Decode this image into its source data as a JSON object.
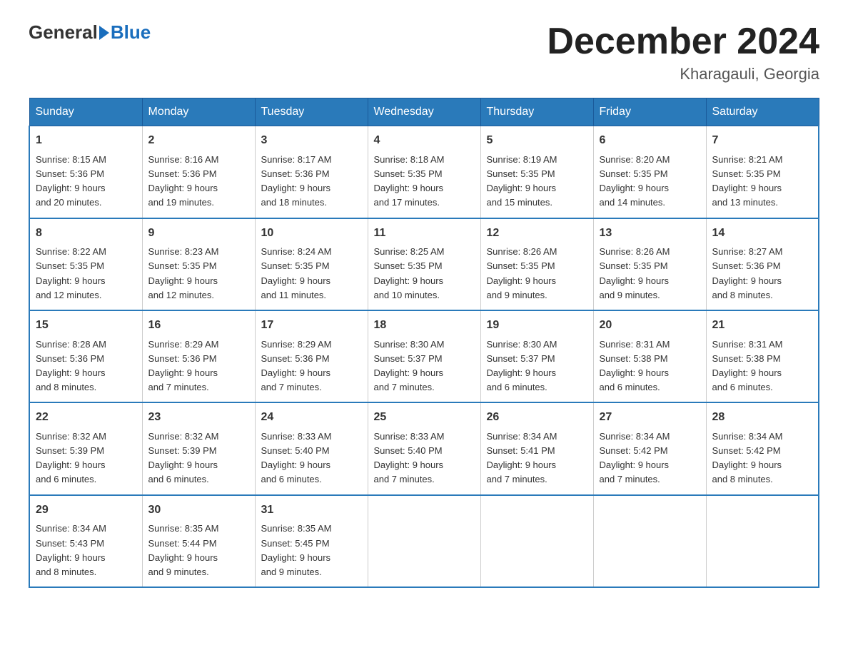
{
  "logo": {
    "general": "General",
    "blue": "Blue"
  },
  "title": "December 2024",
  "location": "Kharagauli, Georgia",
  "days_of_week": [
    "Sunday",
    "Monday",
    "Tuesday",
    "Wednesday",
    "Thursday",
    "Friday",
    "Saturday"
  ],
  "weeks": [
    [
      {
        "day": "1",
        "sunrise": "8:15 AM",
        "sunset": "5:36 PM",
        "daylight": "9 hours and 20 minutes."
      },
      {
        "day": "2",
        "sunrise": "8:16 AM",
        "sunset": "5:36 PM",
        "daylight": "9 hours and 19 minutes."
      },
      {
        "day": "3",
        "sunrise": "8:17 AM",
        "sunset": "5:36 PM",
        "daylight": "9 hours and 18 minutes."
      },
      {
        "day": "4",
        "sunrise": "8:18 AM",
        "sunset": "5:35 PM",
        "daylight": "9 hours and 17 minutes."
      },
      {
        "day": "5",
        "sunrise": "8:19 AM",
        "sunset": "5:35 PM",
        "daylight": "9 hours and 15 minutes."
      },
      {
        "day": "6",
        "sunrise": "8:20 AM",
        "sunset": "5:35 PM",
        "daylight": "9 hours and 14 minutes."
      },
      {
        "day": "7",
        "sunrise": "8:21 AM",
        "sunset": "5:35 PM",
        "daylight": "9 hours and 13 minutes."
      }
    ],
    [
      {
        "day": "8",
        "sunrise": "8:22 AM",
        "sunset": "5:35 PM",
        "daylight": "9 hours and 12 minutes."
      },
      {
        "day": "9",
        "sunrise": "8:23 AM",
        "sunset": "5:35 PM",
        "daylight": "9 hours and 12 minutes."
      },
      {
        "day": "10",
        "sunrise": "8:24 AM",
        "sunset": "5:35 PM",
        "daylight": "9 hours and 11 minutes."
      },
      {
        "day": "11",
        "sunrise": "8:25 AM",
        "sunset": "5:35 PM",
        "daylight": "9 hours and 10 minutes."
      },
      {
        "day": "12",
        "sunrise": "8:26 AM",
        "sunset": "5:35 PM",
        "daylight": "9 hours and 9 minutes."
      },
      {
        "day": "13",
        "sunrise": "8:26 AM",
        "sunset": "5:35 PM",
        "daylight": "9 hours and 9 minutes."
      },
      {
        "day": "14",
        "sunrise": "8:27 AM",
        "sunset": "5:36 PM",
        "daylight": "9 hours and 8 minutes."
      }
    ],
    [
      {
        "day": "15",
        "sunrise": "8:28 AM",
        "sunset": "5:36 PM",
        "daylight": "9 hours and 8 minutes."
      },
      {
        "day": "16",
        "sunrise": "8:29 AM",
        "sunset": "5:36 PM",
        "daylight": "9 hours and 7 minutes."
      },
      {
        "day": "17",
        "sunrise": "8:29 AM",
        "sunset": "5:36 PM",
        "daylight": "9 hours and 7 minutes."
      },
      {
        "day": "18",
        "sunrise": "8:30 AM",
        "sunset": "5:37 PM",
        "daylight": "9 hours and 7 minutes."
      },
      {
        "day": "19",
        "sunrise": "8:30 AM",
        "sunset": "5:37 PM",
        "daylight": "9 hours and 6 minutes."
      },
      {
        "day": "20",
        "sunrise": "8:31 AM",
        "sunset": "5:38 PM",
        "daylight": "9 hours and 6 minutes."
      },
      {
        "day": "21",
        "sunrise": "8:31 AM",
        "sunset": "5:38 PM",
        "daylight": "9 hours and 6 minutes."
      }
    ],
    [
      {
        "day": "22",
        "sunrise": "8:32 AM",
        "sunset": "5:39 PM",
        "daylight": "9 hours and 6 minutes."
      },
      {
        "day": "23",
        "sunrise": "8:32 AM",
        "sunset": "5:39 PM",
        "daylight": "9 hours and 6 minutes."
      },
      {
        "day": "24",
        "sunrise": "8:33 AM",
        "sunset": "5:40 PM",
        "daylight": "9 hours and 6 minutes."
      },
      {
        "day": "25",
        "sunrise": "8:33 AM",
        "sunset": "5:40 PM",
        "daylight": "9 hours and 7 minutes."
      },
      {
        "day": "26",
        "sunrise": "8:34 AM",
        "sunset": "5:41 PM",
        "daylight": "9 hours and 7 minutes."
      },
      {
        "day": "27",
        "sunrise": "8:34 AM",
        "sunset": "5:42 PM",
        "daylight": "9 hours and 7 minutes."
      },
      {
        "day": "28",
        "sunrise": "8:34 AM",
        "sunset": "5:42 PM",
        "daylight": "9 hours and 8 minutes."
      }
    ],
    [
      {
        "day": "29",
        "sunrise": "8:34 AM",
        "sunset": "5:43 PM",
        "daylight": "9 hours and 8 minutes."
      },
      {
        "day": "30",
        "sunrise": "8:35 AM",
        "sunset": "5:44 PM",
        "daylight": "9 hours and 9 minutes."
      },
      {
        "day": "31",
        "sunrise": "8:35 AM",
        "sunset": "5:45 PM",
        "daylight": "9 hours and 9 minutes."
      },
      null,
      null,
      null,
      null
    ]
  ],
  "labels": {
    "sunrise": "Sunrise:",
    "sunset": "Sunset:",
    "daylight": "Daylight:"
  }
}
